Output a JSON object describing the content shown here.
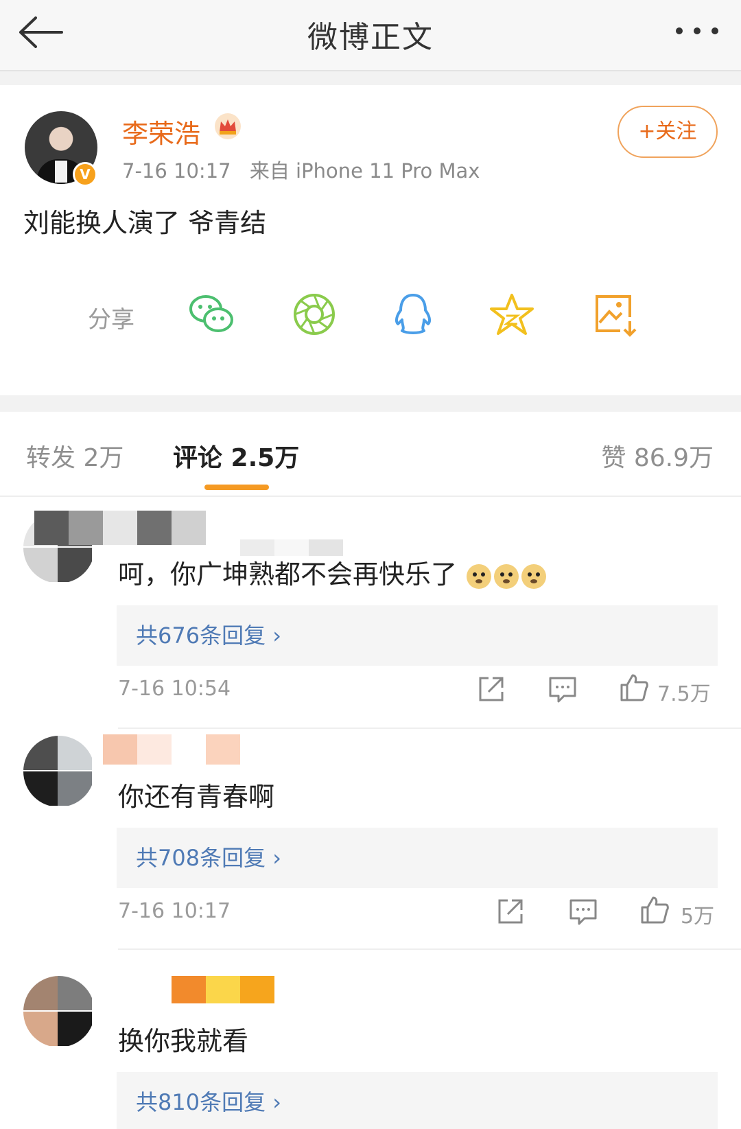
{
  "nav": {
    "title": "微博正文"
  },
  "post": {
    "author": "李荣浩",
    "verified_badge": "V",
    "time": "7-16 10:17",
    "source": "来自 iPhone 11 Pro Max",
    "follow_label": "+关注",
    "text": "刘能换人演了 爷青结",
    "share_label": "分享",
    "share_targets": [
      "wechat-icon",
      "moments-icon",
      "qq-icon",
      "qzone-icon",
      "save-image-icon"
    ]
  },
  "tabs": {
    "repost": "转发 2万",
    "comment": "评论 2.5万",
    "like": "赞 86.9万"
  },
  "comments": [
    {
      "text": "呵，你广坤熟都不会再快乐了",
      "emoji": "doge-emoji x3",
      "replies": "共676条回复",
      "time": "7-16 10:54",
      "likes": "7.5万"
    },
    {
      "text": "你还有青春啊",
      "replies": "共708条回复",
      "time": "7-16 10:17",
      "likes": "5万"
    },
    {
      "text": "换你我就看",
      "replies": "共810条回复"
    }
  ],
  "colors": {
    "accent": "#e86a1a",
    "link": "#4f7ab5",
    "tab_indicator": "#f59a23"
  }
}
